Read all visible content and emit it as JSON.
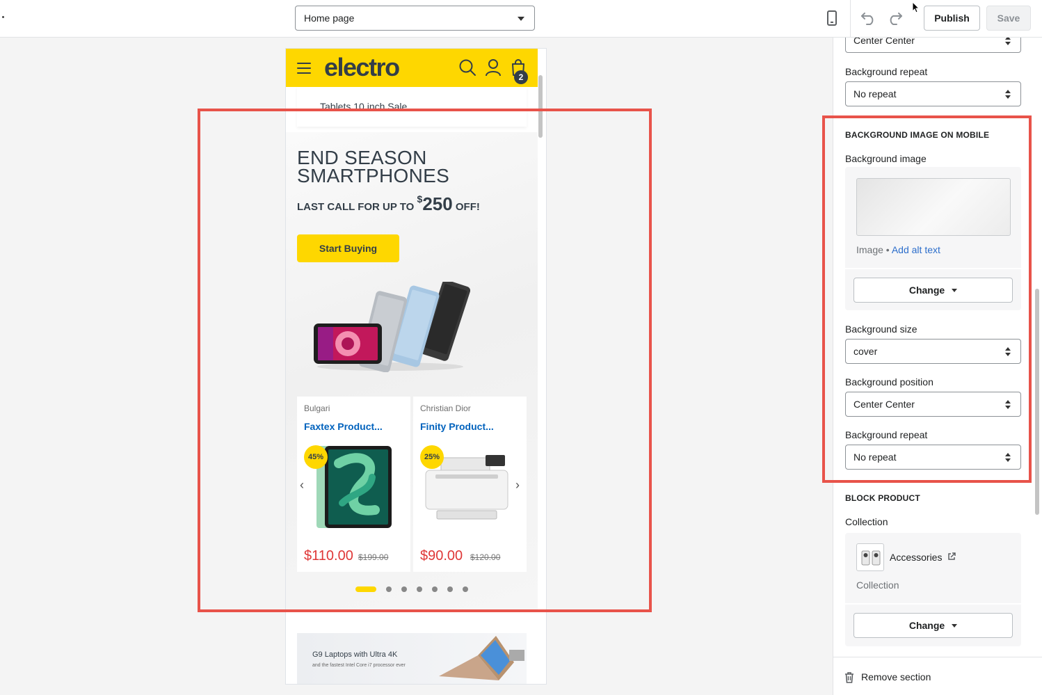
{
  "topbar": {
    "page_select": "Home page",
    "publish_label": "Publish",
    "save_label": "Save",
    "icons": [
      "mobile-device-icon",
      "undo-icon",
      "redo-icon"
    ]
  },
  "preview": {
    "logo": "electro",
    "cart_count": "2",
    "menu_item": "Tablets 10 inch Sale",
    "slide": {
      "title_line1": "END SEASON",
      "title_line2": "SMARTPHONES",
      "sub_prefix": "LAST CALL FOR UP TO ",
      "currency": "$",
      "amount": "250",
      "sub_suffix": " OFF!",
      "button": "Start Buying"
    },
    "products": [
      {
        "brand": "Bulgari",
        "name": "Faxtex Product...",
        "badge": "45%",
        "price": "$110.00",
        "old_price": "$199.00"
      },
      {
        "brand": "Christian Dior",
        "name": "Finity Product...",
        "badge": "25%",
        "price": "$90.00",
        "old_price": "$120.00"
      }
    ],
    "laptop_banner": {
      "title": "G9 Laptops with Ultra 4K",
      "subtitle": "and the fastest Intel Core i7 processor ever"
    },
    "accent_color": "#fed700"
  },
  "panel": {
    "top_select_value": "Center Center",
    "bg_repeat_label": "Background repeat",
    "bg_repeat_value": "No repeat",
    "mobile_section": {
      "heading": "BACKGROUND IMAGE ON MOBILE",
      "bg_image_label": "Background image",
      "image_meta": "Image",
      "alt_link": "Add alt text",
      "change_label": "Change",
      "bg_size_label": "Background size",
      "bg_size_value": "cover",
      "bg_position_label": "Background position",
      "bg_position_value": "Center Center",
      "bg_repeat_label": "Background repeat",
      "bg_repeat_value": "No repeat"
    },
    "block_product": {
      "heading": "BLOCK PRODUCT",
      "collection_label": "Collection",
      "collection_name": "Accessories",
      "collection_type": "Collection",
      "change_label": "Change"
    },
    "remove_label": "Remove section",
    "highlight_color": "#e8534a"
  }
}
